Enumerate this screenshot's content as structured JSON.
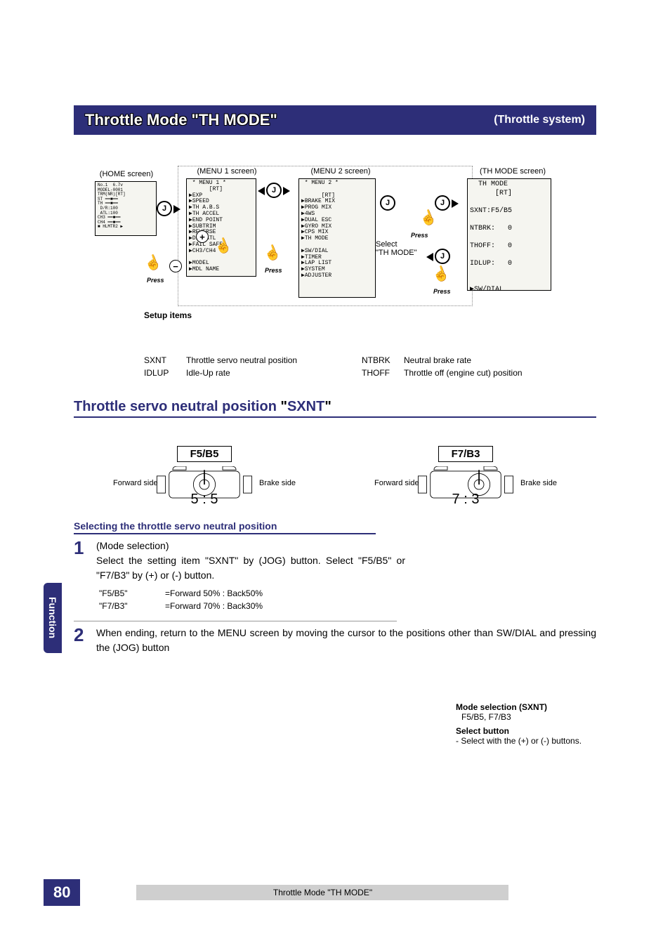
{
  "titlebar": {
    "left": "Throttle Mode \"TH MODE\"",
    "right": "(Throttle system)"
  },
  "flow": {
    "home_label": "(HOME screen)",
    "menu1_label": "(MENU 1 screen)",
    "menu2_label": "(MENU 2 screen)",
    "thmode_label": "(TH MODE screen)",
    "select_text": "Select\n\"TH MODE\"",
    "press": "Press",
    "jog": "J",
    "plus": "+",
    "minus": "−",
    "menu1_lcd": " * MENU 1 *\n      [RT]\n▶EXP\n▶SPEED\n▶TH A.B.S\n▶TH ACCEL\n▶END POINT\n▶SUBTRIM\n▶REVERSE\n▶D/R ATL\n▶FAIL SAFE\n▶CH3/CH4\n\n▶MODEL\n▶MDL NAME",
    "menu2_lcd": " * MENU 2 *\n\n      [RT]\n▶BRAKE MIX\n▶PROG MIX\n▶4WS\n▶DUAL ESC\n▶GYRO MIX\n▶CPS MIX\n▶TH MODE\n\n▶SW/DIAL\n▶TIMER\n▶LAP LIST\n▶SYSTEM\n▶ADJUSTER",
    "thmode_lcd": "  TH MODE\n      [RT]\n\nSXNT:F5/B5\n\nNTBRK:   0\n\nTHOFF:   0\n\nIDLUP:   0\n\n\n▶SW/DIAL"
  },
  "setup": {
    "heading": "Setup items",
    "r1c1": "SXNT",
    "r1c2": "Throttle servo neutral position",
    "r1c3": "NTBRK",
    "r1c4": "Neutral brake rate",
    "r2c1": "IDLUP",
    "r2c2": "Idle-Up rate",
    "r2c3": "THOFF",
    "r2c4": "Throttle off (engine cut) position"
  },
  "section": {
    "prefix": "Throttle servo neutral position ",
    "q1": "\"",
    "name": "SXNT",
    "q2": "\""
  },
  "ratio": {
    "left_label": "F5/B5",
    "right_label": "F7/B3",
    "fwd": "Forward side",
    "brk": "Brake side",
    "left_num": "5 : 5",
    "right_num": "7 : 3"
  },
  "sel_heading": "Selecting the throttle servo neutral position",
  "steps": {
    "s1_title": "(Mode selection)",
    "s1_body": "Select the setting item \"SXNT\" by (JOG) button. Select \"F5/B5\" or \"F7/B3\" by (+) or (-) button.",
    "codes": {
      "a1": "\"F5/B5\"",
      "a2": "=Forward 50% : Back50%",
      "b1": "\"F7/B3\"",
      "b2": "=Forward 70% : Back30%"
    },
    "s2_body": "When ending, return to the MENU screen by moving the cursor to the positions other than SW/DIAL and pressing the (JOG) button"
  },
  "rightcol": {
    "h1": "Mode selection (SXNT)",
    "h1sub": "F5/B5, F7/B3",
    "h2": "Select button",
    "h2sub": "- Select with the (+) or (-) buttons."
  },
  "footer": {
    "page": "80",
    "caption": "Throttle Mode \"TH MODE\""
  },
  "func_tab": "Function",
  "nums": {
    "one": "1",
    "two": "2"
  }
}
